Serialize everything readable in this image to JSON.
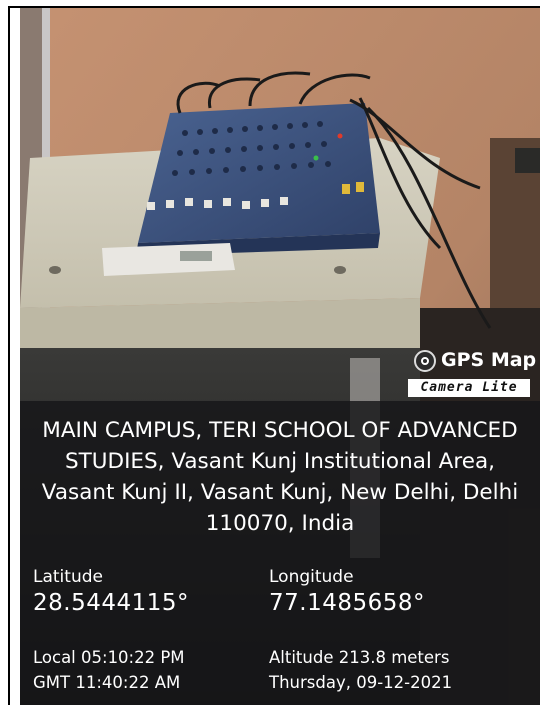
{
  "badge": {
    "title": "GPS Map",
    "subtitle": "Camera Lite",
    "icon": "camera-icon"
  },
  "address": "MAIN CAMPUS, TERI SCHOOL OF ADVANCED STUDIES, Vasant Kunj Institutional Area, Vasant Kunj II, Vasant Kunj, New Delhi, Delhi 110070, India",
  "coordinates": {
    "latitude_label": "Latitude",
    "latitude_value": "28.5444115°",
    "longitude_label": "Longitude",
    "longitude_value": "77.1485658°"
  },
  "meta": {
    "local_time": "Local 05:10:22 PM",
    "gmt_time": "GMT 11:40:22 AM",
    "altitude": "Altitude 213.8 meters",
    "date": "Thursday, 09-12-2021"
  },
  "colors": {
    "wall": "#b9896a",
    "cabinet": "#cfcab7",
    "mixer": "#3b4f78",
    "overlay": "#161618"
  }
}
